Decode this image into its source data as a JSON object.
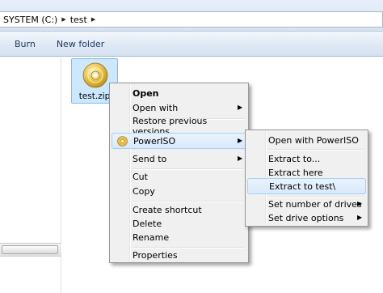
{
  "address": {
    "crumbs": [
      "SYSTEM (C:)",
      "test"
    ]
  },
  "toolbar": {
    "burn_label": "Burn",
    "new_folder_label": "New folder"
  },
  "file": {
    "name": "test.zip",
    "icon": "poweriso-disc-icon"
  },
  "context_menu": {
    "open": "Open",
    "open_with": "Open with",
    "restore": "Restore previous versions",
    "poweriso": "PowerISO",
    "send_to": "Send to",
    "cut": "Cut",
    "copy": "Copy",
    "create_shortcut": "Create shortcut",
    "delete": "Delete",
    "rename": "Rename",
    "properties": "Properties"
  },
  "submenu": {
    "open_with_poweriso": "Open with PowerISO",
    "extract_to": "Extract to...",
    "extract_here": "Extract here",
    "extract_to_test": "Extract to test\\",
    "set_number_of_drives": "Set number of drives",
    "set_drive_options": "Set drive options"
  },
  "colors": {
    "highlight": "#d9e9fb",
    "selection": "#cce8ff",
    "menu_bg": "#f0f0f0"
  }
}
